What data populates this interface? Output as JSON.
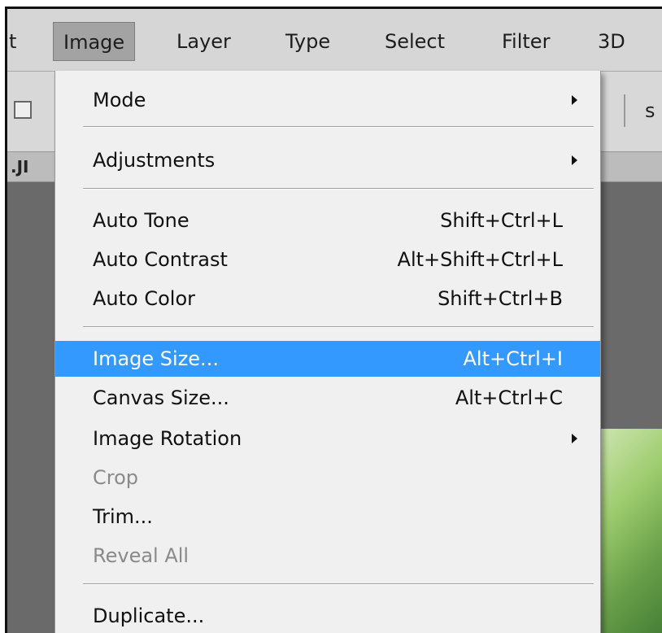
{
  "menubar": {
    "items": [
      {
        "label": "t"
      },
      {
        "label": "Image"
      },
      {
        "label": "Layer"
      },
      {
        "label": "Type"
      },
      {
        "label": "Select"
      },
      {
        "label": "Filter"
      },
      {
        "label": "3D"
      }
    ]
  },
  "optionsbar": {
    "partial_label": "s"
  },
  "doctab": {
    "partial_label": ".JI"
  },
  "image_menu": {
    "items": [
      {
        "label": "Mode",
        "shortcut": "",
        "submenu": true
      },
      {
        "label": "Adjustments",
        "shortcut": "",
        "submenu": true
      },
      {
        "label": "Auto Tone",
        "shortcut": "Shift+Ctrl+L"
      },
      {
        "label": "Auto Contrast",
        "shortcut": "Alt+Shift+Ctrl+L"
      },
      {
        "label": "Auto Color",
        "shortcut": "Shift+Ctrl+B"
      },
      {
        "label": "Image Size...",
        "shortcut": "Alt+Ctrl+I",
        "highlighted": true
      },
      {
        "label": "Canvas Size...",
        "shortcut": "Alt+Ctrl+C"
      },
      {
        "label": "Image Rotation",
        "shortcut": "",
        "submenu": true
      },
      {
        "label": "Crop",
        "shortcut": "",
        "disabled": true
      },
      {
        "label": "Trim...",
        "shortcut": ""
      },
      {
        "label": "Reveal All",
        "shortcut": "",
        "disabled": true
      },
      {
        "label": "Duplicate...",
        "shortcut": ""
      }
    ]
  },
  "colors": {
    "highlight": "#3399ff",
    "menu_bg": "#f0f0f0",
    "menubar_bg": "#d6d6d6",
    "disabled_text": "#8a8a8a"
  }
}
